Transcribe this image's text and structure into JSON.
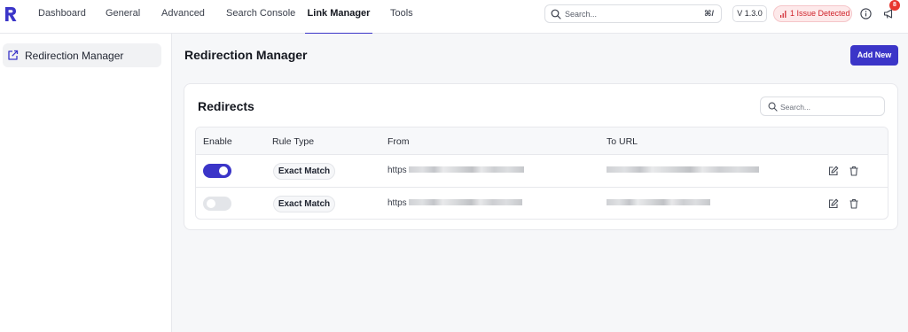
{
  "topnav": {
    "items": [
      {
        "label": "Dashboard",
        "active": false
      },
      {
        "label": "General",
        "active": false
      },
      {
        "label": "Advanced",
        "active": false
      },
      {
        "label": "Search Console",
        "active": false
      },
      {
        "label": "Link Manager",
        "active": true
      },
      {
        "label": "Tools",
        "active": false
      }
    ],
    "search_placeholder": "Search...",
    "search_shortcut": "⌘/",
    "version": "V 1.3.0",
    "issue_label": "1 Issue Detected",
    "notification_count": "8"
  },
  "sidebar": {
    "items": [
      {
        "label": "Redirection Manager",
        "icon": "external-link-icon"
      }
    ]
  },
  "page": {
    "title": "Redirection Manager",
    "add_button": "Add New"
  },
  "redirects": {
    "title": "Redirects",
    "search_placeholder": "Search...",
    "columns": [
      "Enable",
      "Rule Type",
      "From",
      "To URL"
    ],
    "rows": [
      {
        "enabled": true,
        "rule_type": "Exact Match",
        "from": "https"
      },
      {
        "enabled": false,
        "rule_type": "Exact Match",
        "from": "https"
      }
    ]
  },
  "colors": {
    "accent": "#3b35c8",
    "issue": "#d0242c",
    "badge": "#e8372f"
  }
}
